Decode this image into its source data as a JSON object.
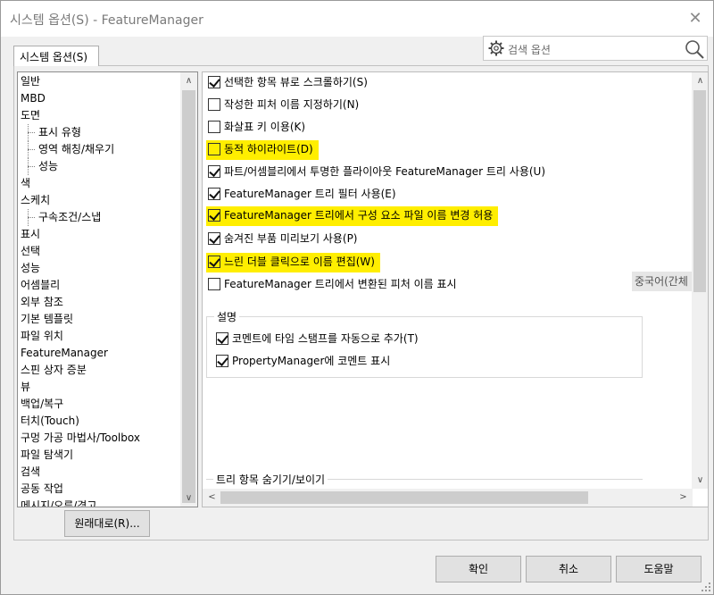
{
  "window": {
    "title": "시스템 옵션(S) - FeatureManager",
    "close_glyph": "✕"
  },
  "tab": {
    "label": "시스템 옵션(S)"
  },
  "search": {
    "label": "검색 옵션",
    "icon_left": "gear-icon",
    "icon_right": "magnifier-icon"
  },
  "tree": {
    "items": [
      {
        "label": "일반",
        "child": false
      },
      {
        "label": "MBD",
        "child": false
      },
      {
        "label": "도면",
        "child": false
      },
      {
        "label": "표시 유형",
        "child": true
      },
      {
        "label": "영역 해칭/채우기",
        "child": true
      },
      {
        "label": "성능",
        "child": true
      },
      {
        "label": "색",
        "child": false
      },
      {
        "label": "스케치",
        "child": false
      },
      {
        "label": "구속조건/스냅",
        "child": true
      },
      {
        "label": "표시",
        "child": false
      },
      {
        "label": "선택",
        "child": false
      },
      {
        "label": "성능",
        "child": false
      },
      {
        "label": "어셈블리",
        "child": false
      },
      {
        "label": "외부 참조",
        "child": false
      },
      {
        "label": "기본 템플릿",
        "child": false
      },
      {
        "label": "파일 위치",
        "child": false
      },
      {
        "label": "FeatureManager",
        "child": false,
        "selected": true
      },
      {
        "label": "스핀 상자 증분",
        "child": false
      },
      {
        "label": "뷰",
        "child": false
      },
      {
        "label": "백업/복구",
        "child": false
      },
      {
        "label": "터치(Touch)",
        "child": false
      },
      {
        "label": "구멍 가공 마법사/Toolbox",
        "child": false
      },
      {
        "label": "파일 탐색기",
        "child": false
      },
      {
        "label": "검색",
        "child": false
      },
      {
        "label": "공동 작업",
        "child": false
      },
      {
        "label": "메시지/오류/경고",
        "child": false
      }
    ]
  },
  "options": [
    {
      "label": "선택한 항목 뷰로 스크롤하기(S)",
      "checked": true,
      "highlight": false
    },
    {
      "label": "작성한 피처 이름 지정하기(N)",
      "checked": false,
      "highlight": false
    },
    {
      "label": "화살표 키 이용(K)",
      "checked": false,
      "highlight": false
    },
    {
      "label": "동적 하이라이트(D)",
      "checked": false,
      "highlight": true
    },
    {
      "label": "파트/어셈블리에서 투명한 플라이아웃 FeatureManager 트리 사용(U)",
      "checked": true,
      "highlight": false
    },
    {
      "label": "FeatureManager 트리 필터 사용(E)",
      "checked": true,
      "highlight": false
    },
    {
      "label": "FeatureManager 트리에서 구성 요소 파일 이름 변경 허용",
      "checked": true,
      "highlight": true
    },
    {
      "label": "숨겨진 부품 미리보기 사용(P)",
      "checked": true,
      "highlight": false
    },
    {
      "label": "느린 더블 클릭으로 이름 편집(W)",
      "checked": true,
      "highlight": true
    },
    {
      "label": "FeatureManager 트리에서 변환된 피처 이름 표시",
      "checked": false,
      "highlight": false
    }
  ],
  "language_tag": "중국어(간체",
  "description_group": {
    "title": "설명",
    "options": [
      {
        "label": "코멘트에 타임 스탬프를 자동으로 추가(T)",
        "checked": true
      },
      {
        "label": "PropertyManager에 코멘트 표시",
        "checked": true
      }
    ]
  },
  "tree_visibility_group": {
    "title": "트리 항목 숨기기/보이기"
  },
  "buttons": {
    "reset": "원래대로(R)...",
    "ok": "확인",
    "cancel": "취소",
    "help": "도움말"
  },
  "scroll_glyphs": {
    "up": "∧",
    "down": "∨",
    "left": "<",
    "right": ">"
  }
}
